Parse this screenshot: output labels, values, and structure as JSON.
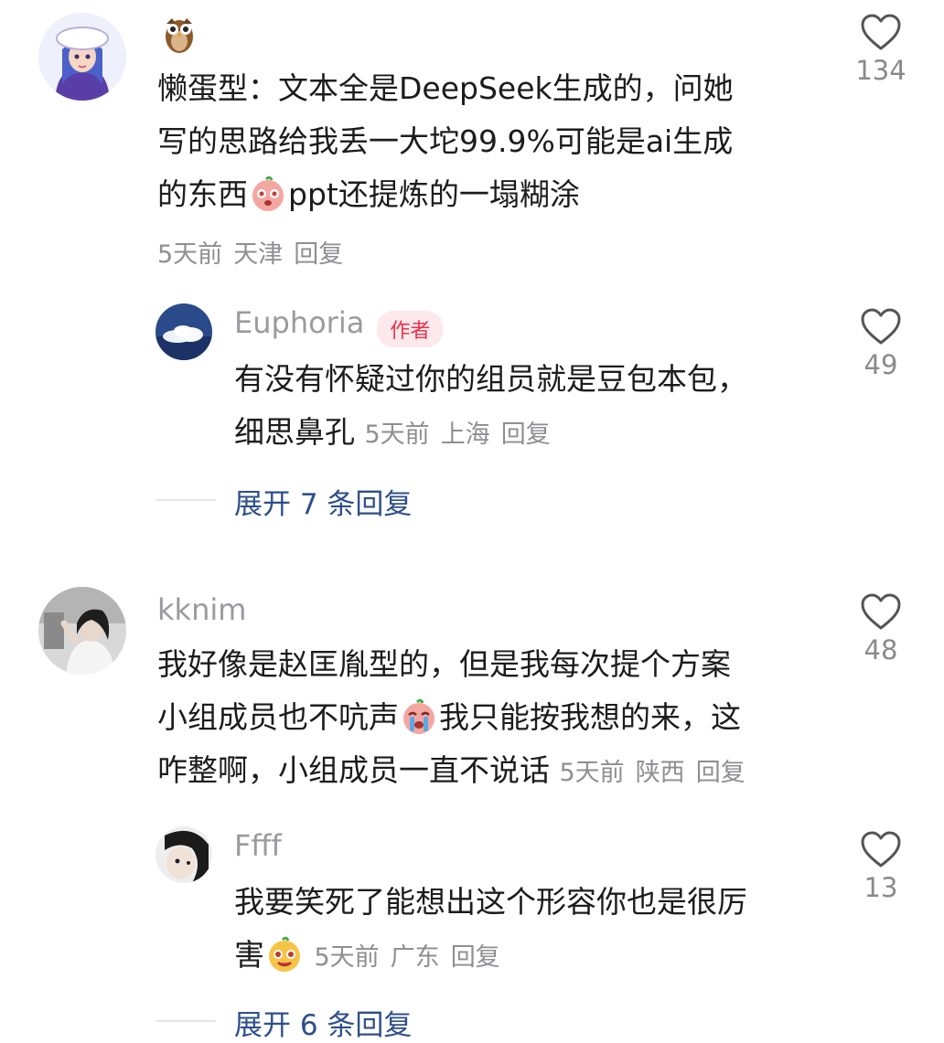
{
  "comments": [
    {
      "user_emoji": "owl",
      "text_lines": [
        "懒蛋型：文本全是DeepSeek生成的，问她",
        "写的思路给我丢一大坨99.9%可能是ai生成",
        "的东西"
      ],
      "text_after_emoji": "ppt还提炼的一塌糊涂",
      "time": "5天前",
      "location": "天津",
      "reply": "回复",
      "likes": "134"
    },
    {
      "username": "Euphoria",
      "badge": "作者",
      "text_lines": [
        "有没有怀疑过你的组员就是豆包本包，",
        "细思鼻孔"
      ],
      "time": "5天前",
      "location": "上海",
      "reply": "回复",
      "likes": "49"
    },
    {
      "username": "kknim",
      "text_lines": [
        "我好像是赵匡胤型的，但是我每次提个方案",
        "小组成员也不吭声"
      ],
      "text_after_emoji": "我只能按我想的来，这",
      "text_line3": "咋整啊，小组成员一直不说话",
      "time": "5天前",
      "location": "陕西",
      "reply": "回复",
      "likes": "48"
    },
    {
      "username": "Ffff",
      "text_lines": [
        "我要笑死了能想出这个形容你也是很厉",
        "害"
      ],
      "time": "5天前",
      "location": "广东",
      "reply": "回复",
      "likes": "13"
    }
  ],
  "expand": [
    {
      "label": "展开 7 条回复"
    },
    {
      "label": "展开 6 条回复"
    }
  ],
  "icons": {
    "heart": "heart-outline-icon",
    "accent": "#2d4f8a",
    "badge_color": "#e8334a"
  }
}
